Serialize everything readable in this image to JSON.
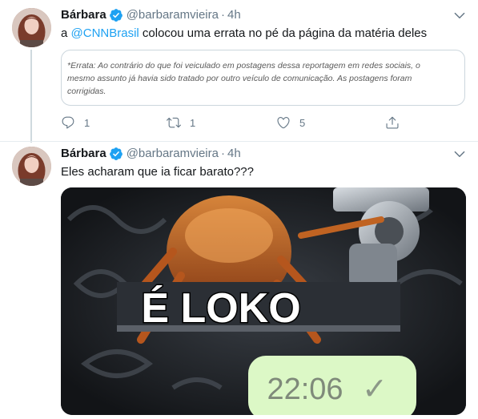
{
  "tweets": [
    {
      "name": "Bárbara",
      "handle": "@barbaramvieira",
      "dot": "·",
      "time": "4h",
      "text_before": "a ",
      "mention": "@CNNBrasil",
      "text_after": " colocou uma errata no pé da página da matéria deles",
      "quote_lines": [
        "*Errata: Ao contrário do que foi veiculado em postagens dessa reportagem em redes sociais, o",
        "mesmo assunto já havia sido tratado por outro veículo de comunicação. As postagens foram",
        "corrigidas."
      ],
      "replies": "1",
      "retweets": "1",
      "likes": "5"
    },
    {
      "name": "Bárbara",
      "handle": "@barbaramvieira",
      "dot": "·",
      "time": "4h",
      "text": "Eles acharam que ia ficar barato???",
      "media": {
        "caption": "É LOKO",
        "clock": "22:06",
        "check": "✓"
      }
    }
  ],
  "colors": {
    "accent": "#1da1f2",
    "secondary_text": "#657786",
    "border": "#ccd6dd"
  },
  "icons": [
    "verified-badge-icon",
    "chevron-down-icon",
    "reply-icon",
    "retweet-icon",
    "like-icon",
    "share-icon"
  ]
}
